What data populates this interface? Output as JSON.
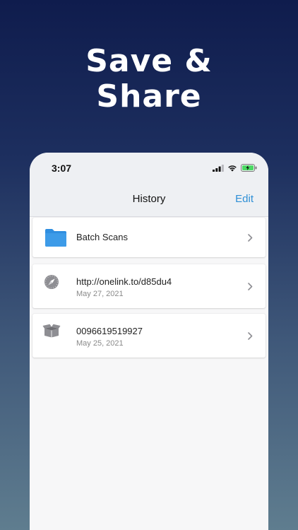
{
  "headline": {
    "line1": "Save &",
    "line2": "Share"
  },
  "status_bar": {
    "time": "3:07"
  },
  "nav": {
    "title": "History",
    "edit_label": "Edit"
  },
  "list": {
    "items": [
      {
        "type": "folder",
        "icon": "folder-icon",
        "label": "Batch Scans",
        "sub": ""
      },
      {
        "type": "url",
        "icon": "compass-icon",
        "label": "http://onelink.to/d85du4",
        "sub": "May 27, 2021"
      },
      {
        "type": "barcode",
        "icon": "box-icon",
        "label": "0096619519927",
        "sub": "May 25, 2021"
      }
    ]
  },
  "colors": {
    "accent": "#2e8fd6",
    "folder": "#2f8ee0",
    "icon_gray": "#8e8e93"
  }
}
